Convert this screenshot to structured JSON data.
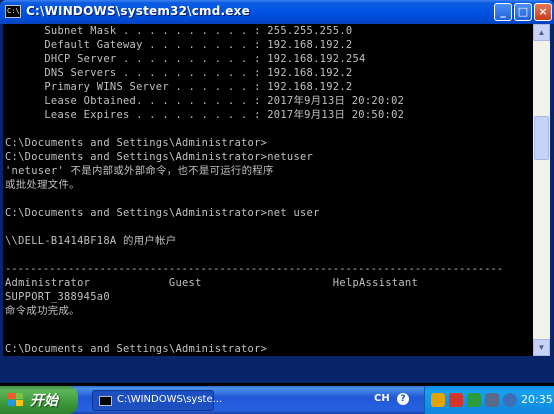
{
  "window": {
    "title": "C:\\WINDOWS\\system32\\cmd.exe",
    "minimize": "_",
    "maximize": "□",
    "close": "×"
  },
  "console": {
    "lines": [
      "      Subnet Mask . . . . . . . . . . : 255.255.255.0",
      "      Default Gateway . . . . . . . . : 192.168.192.2",
      "      DHCP Server . . . . . . . . . . : 192.168.192.254",
      "      DNS Servers . . . . . . . . . . : 192.168.192.2",
      "      Primary WINS Server . . . . . . : 192.168.192.2",
      "      Lease Obtained. . . . . . . . . : 2017年9月13日 20:20:02",
      "      Lease Expires . . . . . . . . . : 2017年9月13日 20:50:02",
      "",
      "C:\\Documents and Settings\\Administrator>",
      "C:\\Documents and Settings\\Administrator>netuser",
      "'netuser' 不是内部或外部命令，也不是可运行的程序",
      "或批处理文件。",
      "",
      "C:\\Documents and Settings\\Administrator>net user",
      "",
      "\\\\DELL-B1414BF18A 的用户帐户",
      "",
      "-------------------------------------------------------------------------------",
      "Administrator            Guest                    HelpAssistant",
      "SUPPORT_388945a0",
      "命令成功完成。",
      "",
      "",
      "C:\\Documents and Settings\\Administrator>"
    ]
  },
  "scrollbar": {
    "up": "▲",
    "down": "▼"
  },
  "taskbar": {
    "start_label": "开始",
    "task_button_label": "C:\\WINDOWS\\syste...",
    "ime_label": "CH",
    "ime_help": "?",
    "clock": "20:35"
  }
}
